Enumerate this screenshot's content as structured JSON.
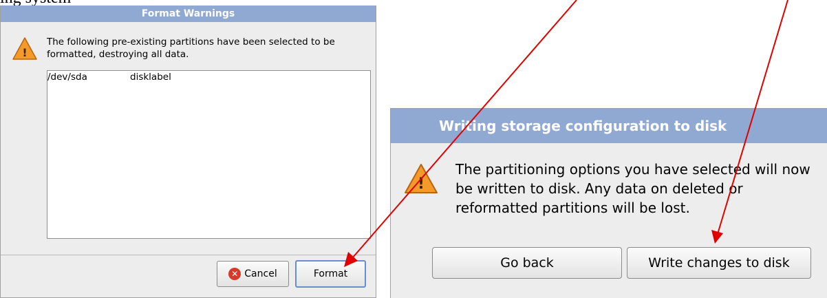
{
  "page_heading": "ing system",
  "format_dialog": {
    "title": "Format Warnings",
    "message": "The following pre-existing partitions have been selected to be formatted, destroying all data.",
    "list_rows": [
      {
        "device": "/dev/sda",
        "type": "disklabel"
      }
    ],
    "cancel_label": "Cancel",
    "format_label": "Format"
  },
  "write_dialog": {
    "title": "Writing storage configuration to disk",
    "message": "The partitioning options you have selected will now be written to disk.  Any data on deleted or reformatted partitions will be lost.",
    "back_label": "Go back",
    "write_label": "Write changes to disk"
  },
  "icons": {
    "warning": "warning-triangle-icon",
    "cancel": "cancel-circle-icon"
  },
  "colors": {
    "titlebar": "#90a9d3",
    "arrow": "#e00000",
    "warning": "#f08a1c"
  }
}
